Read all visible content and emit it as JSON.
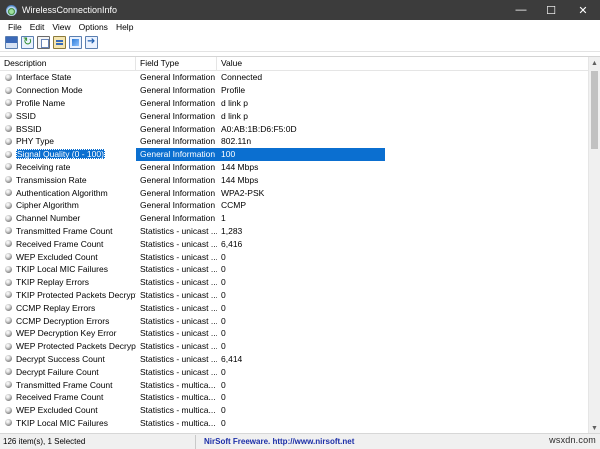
{
  "window": {
    "title": "WirelessConnectionInfo",
    "minimize_glyph": "—",
    "maximize_glyph": "☐",
    "close_glyph": "✕"
  },
  "menu": [
    "File",
    "Edit",
    "View",
    "Options",
    "Help"
  ],
  "toolbar": {
    "icons": [
      "save-icon",
      "refresh-icon",
      "copy-icon",
      "properties-icon",
      "html-report-icon",
      "exit-icon"
    ]
  },
  "columns": [
    "Description",
    "Field Type",
    "Value"
  ],
  "rows": [
    {
      "description": "Interface State",
      "field_type": "General Information",
      "value": "Connected"
    },
    {
      "description": "Connection Mode",
      "field_type": "General Information",
      "value": "Profile"
    },
    {
      "description": "Profile Name",
      "field_type": "General Information",
      "value": "d link p"
    },
    {
      "description": "SSID",
      "field_type": "General Information",
      "value": "d link p"
    },
    {
      "description": "BSSID",
      "field_type": "General Information",
      "value": "A0:AB:1B:D6:F5:0D"
    },
    {
      "description": "PHY Type",
      "field_type": "General Information",
      "value": "802.11n"
    },
    {
      "description": "Signal Quality (0 - 100)",
      "field_type": "General Information",
      "value": "100",
      "selected": true
    },
    {
      "description": "Receiving rate",
      "field_type": "General Information",
      "value": "144 Mbps"
    },
    {
      "description": "Transmission Rate",
      "field_type": "General Information",
      "value": "144 Mbps"
    },
    {
      "description": "Authentication Algorithm",
      "field_type": "General Information",
      "value": "WPA2-PSK"
    },
    {
      "description": "Cipher Algorithm",
      "field_type": "General Information",
      "value": "CCMP"
    },
    {
      "description": "Channel Number",
      "field_type": "General Information",
      "value": "1"
    },
    {
      "description": "Transmitted Frame Count",
      "field_type": "Statistics - unicast ...",
      "value": "1,283"
    },
    {
      "description": "Received Frame Count",
      "field_type": "Statistics - unicast ...",
      "value": "6,416"
    },
    {
      "description": "WEP Excluded Count",
      "field_type": "Statistics - unicast ...",
      "value": "0"
    },
    {
      "description": "TKIP Local MIC Failures",
      "field_type": "Statistics - unicast ...",
      "value": "0"
    },
    {
      "description": "TKIP Replay Errors",
      "field_type": "Statistics - unicast ...",
      "value": "0"
    },
    {
      "description": "TKIP Protected Packets Decrypt...",
      "field_type": "Statistics - unicast ...",
      "value": "0"
    },
    {
      "description": "CCMP Replay Errors",
      "field_type": "Statistics - unicast ...",
      "value": "0"
    },
    {
      "description": "CCMP Decryption Errors",
      "field_type": "Statistics - unicast ...",
      "value": "0"
    },
    {
      "description": "WEP Decryption Key Error",
      "field_type": "Statistics - unicast ...",
      "value": "0"
    },
    {
      "description": "WEP Protected Packets Decrypt...",
      "field_type": "Statistics - unicast ...",
      "value": "0"
    },
    {
      "description": "Decrypt Success Count",
      "field_type": "Statistics - unicast ...",
      "value": "6,414"
    },
    {
      "description": "Decrypt Failure Count",
      "field_type": "Statistics - unicast ...",
      "value": "0"
    },
    {
      "description": "Transmitted Frame Count",
      "field_type": "Statistics - multica...",
      "value": "0"
    },
    {
      "description": "Received Frame Count",
      "field_type": "Statistics - multica...",
      "value": "0"
    },
    {
      "description": "WEP Excluded Count",
      "field_type": "Statistics - multica...",
      "value": "0"
    },
    {
      "description": "TKIP Local MIC Failures",
      "field_type": "Statistics - multica...",
      "value": "0"
    }
  ],
  "status": {
    "count": "126 item(s), 1 Selected",
    "link": "NirSoft Freeware.  http://www.nirsoft.net"
  },
  "watermark": "wsxdn.com"
}
